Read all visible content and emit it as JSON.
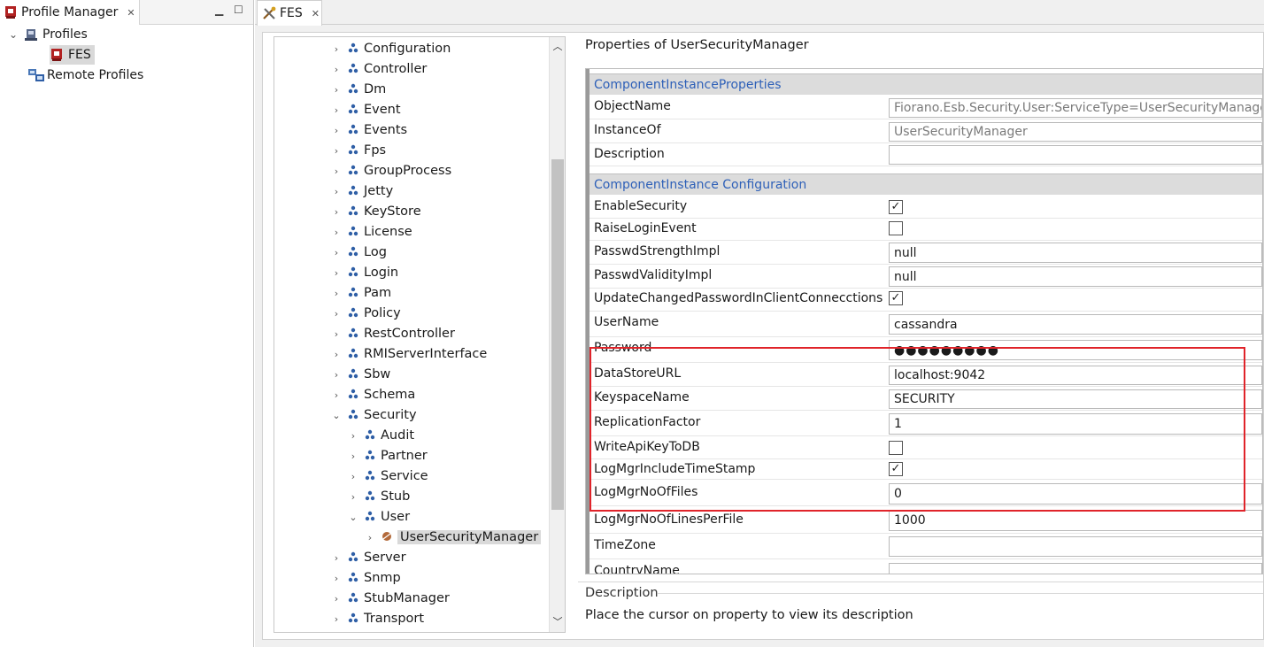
{
  "profile_manager": {
    "tab_title": "Profile Manager",
    "tree": {
      "profiles_label": "Profiles",
      "fes_label": "FES",
      "remote_profiles_label": "Remote Profiles"
    }
  },
  "editor": {
    "tab_title": "FES",
    "module_tree": [
      {
        "label": "Configuration",
        "level": 0,
        "expanded": false
      },
      {
        "label": "Controller",
        "level": 0,
        "expanded": false
      },
      {
        "label": "Dm",
        "level": 0,
        "expanded": false
      },
      {
        "label": "Event",
        "level": 0,
        "expanded": false
      },
      {
        "label": "Events",
        "level": 0,
        "expanded": false
      },
      {
        "label": "Fps",
        "level": 0,
        "expanded": false
      },
      {
        "label": "GroupProcess",
        "level": 0,
        "expanded": false
      },
      {
        "label": "Jetty",
        "level": 0,
        "expanded": false
      },
      {
        "label": "KeyStore",
        "level": 0,
        "expanded": false
      },
      {
        "label": "License",
        "level": 0,
        "expanded": false
      },
      {
        "label": "Log",
        "level": 0,
        "expanded": false
      },
      {
        "label": "Login",
        "level": 0,
        "expanded": false
      },
      {
        "label": "Pam",
        "level": 0,
        "expanded": false
      },
      {
        "label": "Policy",
        "level": 0,
        "expanded": false
      },
      {
        "label": "RestController",
        "level": 0,
        "expanded": false
      },
      {
        "label": "RMIServerInterface",
        "level": 0,
        "expanded": false
      },
      {
        "label": "Sbw",
        "level": 0,
        "expanded": false
      },
      {
        "label": "Schema",
        "level": 0,
        "expanded": false
      },
      {
        "label": "Security",
        "level": 0,
        "expanded": true
      },
      {
        "label": "Audit",
        "level": 1,
        "expanded": false
      },
      {
        "label": "Partner",
        "level": 1,
        "expanded": false
      },
      {
        "label": "Service",
        "level": 1,
        "expanded": false
      },
      {
        "label": "Stub",
        "level": 1,
        "expanded": false
      },
      {
        "label": "User",
        "level": 1,
        "expanded": true
      },
      {
        "label": "UserSecurityManager",
        "level": 2,
        "expanded": false,
        "selected": true
      },
      {
        "label": "Server",
        "level": 0,
        "expanded": false
      },
      {
        "label": "Snmp",
        "level": 0,
        "expanded": false
      },
      {
        "label": "StubManager",
        "level": 0,
        "expanded": false
      },
      {
        "label": "Transport",
        "level": 0,
        "expanded": false
      }
    ],
    "properties": {
      "title": "Properties of UserSecurityManager",
      "section_instance_props": "ComponentInstanceProperties",
      "object_name_label": "ObjectName",
      "object_name_value": "Fiorano.Esb.Security.User:ServiceType=UserSecurityManager,Name=UserSecurityManager",
      "instance_of_label": "InstanceOf",
      "instance_of_value": "UserSecurityManager",
      "description_label": "Description",
      "description_value": "",
      "section_config": "ComponentInstance Configuration",
      "enable_security_label": "EnableSecurity",
      "enable_security_checked": true,
      "raise_login_event_label": "RaiseLoginEvent",
      "raise_login_event_checked": false,
      "passwd_strength_label": "PasswdStrengthImpl",
      "passwd_strength_value": "null",
      "passwd_validity_label": "PasswdValidityImpl",
      "passwd_validity_value": "null",
      "update_changed_pw_label": "UpdateChangedPasswordInClientConneccti​ons",
      "update_changed_pw_checked": true,
      "username_label": "UserName",
      "username_value": "cassandra",
      "password_label": "Password",
      "password_value": "●●●●●●●●●",
      "datastore_url_label": "DataStoreURL",
      "datastore_url_value": "localhost:9042",
      "keyspace_name_label": "KeyspaceName",
      "keyspace_name_value": "SECURITY",
      "replication_factor_label": "ReplicationFactor",
      "replication_factor_value": "1",
      "write_api_key_label": "WriteApiKeyToDB",
      "write_api_key_checked": false,
      "logmgr_timestamp_label": "LogMgrIncludeTimeStamp",
      "logmgr_timestamp_checked": true,
      "logmgr_files_label": "LogMgrNoOfFiles",
      "logmgr_files_value": "0",
      "logmgr_lines_label": "LogMgrNoOfLinesPerFile",
      "logmgr_lines_value": "1000",
      "timezone_label": "TimeZone",
      "timezone_value": "",
      "country_name_label": "CountryName",
      "country_name_value": ""
    },
    "description": {
      "heading": "Description",
      "text": "Place the cursor on property to view its description"
    }
  },
  "colors": {
    "section_text": "#2e60b8",
    "highlight_border": "#e0242a",
    "tree_node_icon": "#2f5fa6"
  }
}
